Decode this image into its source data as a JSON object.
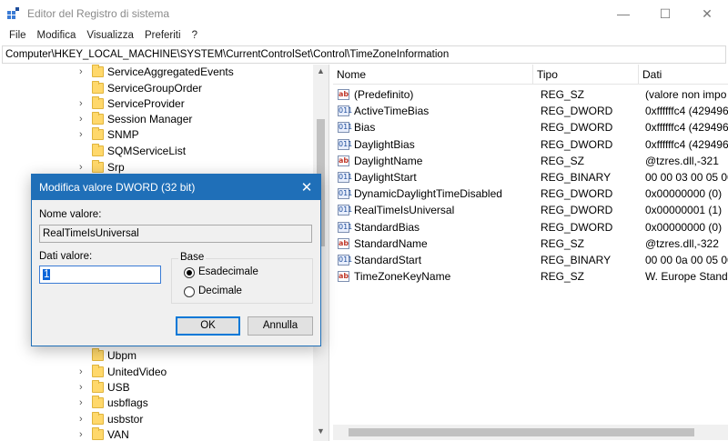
{
  "window": {
    "title": "Editor del Registro di sistema",
    "minimize_glyph": "—",
    "maximize_glyph": "☐",
    "close_glyph": "✕"
  },
  "menu": [
    "File",
    "Modifica",
    "Visualizza",
    "Preferiti",
    "?"
  ],
  "address": "Computer\\HKEY_LOCAL_MACHINE\\SYSTEM\\CurrentControlSet\\Control\\TimeZoneInformation",
  "tree": {
    "items_top": [
      {
        "label": "ServiceAggregatedEvents",
        "expandable": true
      },
      {
        "label": "ServiceGroupOrder",
        "expandable": false
      },
      {
        "label": "ServiceProvider",
        "expandable": true
      },
      {
        "label": "Session Manager",
        "expandable": true
      },
      {
        "label": "SNMP",
        "expandable": true
      },
      {
        "label": "SQMServiceList",
        "expandable": false
      },
      {
        "label": "Srp",
        "expandable": true
      }
    ],
    "items_bottom": [
      {
        "label": "Ubpm",
        "expandable": false
      },
      {
        "label": "UnitedVideo",
        "expandable": true
      },
      {
        "label": "USB",
        "expandable": true
      },
      {
        "label": "usbflags",
        "expandable": true
      },
      {
        "label": "usbstor",
        "expandable": true
      },
      {
        "label": "VAN",
        "expandable": true
      }
    ]
  },
  "list": {
    "columns": [
      "Nome",
      "Tipo",
      "Dati"
    ],
    "rows": [
      {
        "icon": "sz",
        "name": "(Predefinito)",
        "type": "REG_SZ",
        "data": "(valore non impo"
      },
      {
        "icon": "bin",
        "name": "ActiveTimeBias",
        "type": "REG_DWORD",
        "data": "0xffffffc4 (429496"
      },
      {
        "icon": "bin",
        "name": "Bias",
        "type": "REG_DWORD",
        "data": "0xffffffc4 (429496"
      },
      {
        "icon": "bin",
        "name": "DaylightBias",
        "type": "REG_DWORD",
        "data": "0xffffffc4 (429496"
      },
      {
        "icon": "sz",
        "name": "DaylightName",
        "type": "REG_SZ",
        "data": "@tzres.dll,-321"
      },
      {
        "icon": "bin",
        "name": "DaylightStart",
        "type": "REG_BINARY",
        "data": "00 00 03 00 05 00 0"
      },
      {
        "icon": "bin",
        "name": "DynamicDaylightTimeDisabled",
        "type": "REG_DWORD",
        "data": "0x00000000 (0)"
      },
      {
        "icon": "bin",
        "name": "RealTimeIsUniversal",
        "type": "REG_DWORD",
        "data": "0x00000001 (1)"
      },
      {
        "icon": "bin",
        "name": "StandardBias",
        "type": "REG_DWORD",
        "data": "0x00000000 (0)"
      },
      {
        "icon": "sz",
        "name": "StandardName",
        "type": "REG_SZ",
        "data": "@tzres.dll,-322"
      },
      {
        "icon": "bin",
        "name": "StandardStart",
        "type": "REG_BINARY",
        "data": "00 00 0a 00 05 00 0"
      },
      {
        "icon": "sz",
        "name": "TimeZoneKeyName",
        "type": "REG_SZ",
        "data": "W. Europe Standa"
      }
    ]
  },
  "dialog": {
    "title": "Modifica valore DWORD (32 bit)",
    "close_glyph": "✕",
    "name_label": "Nome valore:",
    "name_value": "RealTimeIsUniversal",
    "data_label": "Dati valore:",
    "data_value": "1",
    "base_label": "Base",
    "radio_hex": "Esadecimale",
    "radio_dec": "Decimale",
    "ok_label": "OK",
    "cancel_label": "Annulla"
  },
  "colors": {
    "accent": "#1f6fb8",
    "folder": "#ffd86b"
  }
}
